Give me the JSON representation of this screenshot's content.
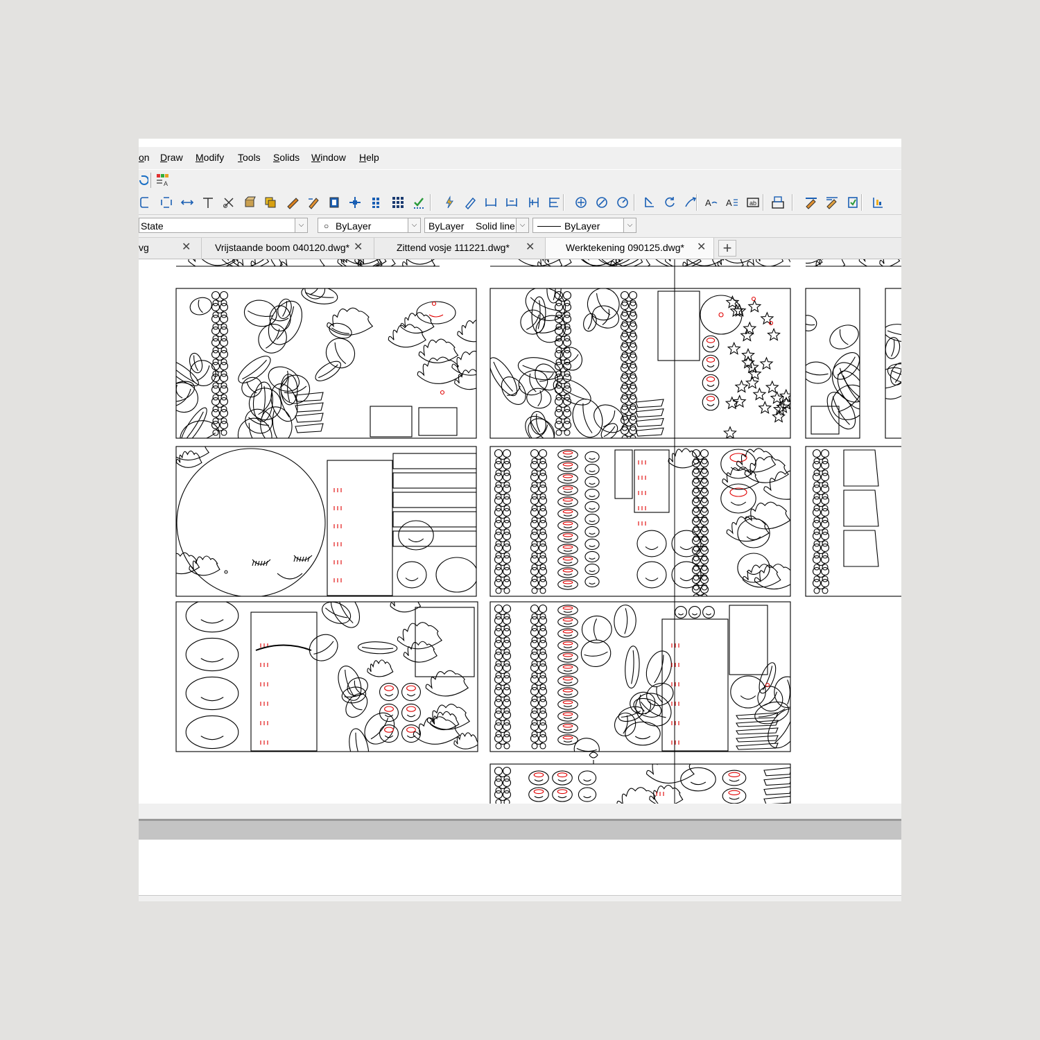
{
  "window": {
    "title_fragment": ""
  },
  "menu": [
    {
      "label": "on"
    },
    {
      "label": "Draw"
    },
    {
      "label": "Modify"
    },
    {
      "label": "Tools"
    },
    {
      "label": "Solids"
    },
    {
      "label": "Window"
    },
    {
      "label": "Help"
    }
  ],
  "toolbar": {
    "icons": [
      "fillet-icon",
      "chamfer-icon",
      "stretch-icon",
      "trim-icon",
      "scissors-icon",
      "explode-icon",
      "copy-icon",
      "pen-icon",
      "pen2-icon",
      "frame-icon",
      "center-move-icon",
      "grid-icon",
      "array-icon",
      "check-icon",
      "snap-icon",
      "pencil-icon",
      "dim-linear-icon",
      "dim-aligned-icon",
      "dim-vertical-icon",
      "dim-baseline-icon",
      "target-icon",
      "compass-icon",
      "gauge-icon",
      "rotate-icon",
      "refresh-icon",
      "arc-icon",
      "text-style-icon",
      "text-edit-icon",
      "field-icon",
      "block-icon",
      "layer-pen-icon",
      "layer-pen2-icon",
      "layer-tool-icon",
      "layer-bar-icon"
    ]
  },
  "properties": {
    "layer_state": "State",
    "color": "ByLayer",
    "linetype_name": "ByLayer",
    "linetype_desc": "Solid line",
    "lineweight": "ByLayer"
  },
  "tabs": [
    {
      "label": "vg",
      "active": false
    },
    {
      "label": "Vrijstaande boom 040120.dwg*",
      "active": false
    },
    {
      "label": "Zittend vosje 111221.dwg*",
      "active": false
    },
    {
      "label": "Werktekening 090125.dwg*",
      "active": true
    }
  ],
  "new_tab_label": "+",
  "close_glyph": "✕",
  "colors": {
    "accent_red": "#e00000",
    "line": "#000000"
  }
}
